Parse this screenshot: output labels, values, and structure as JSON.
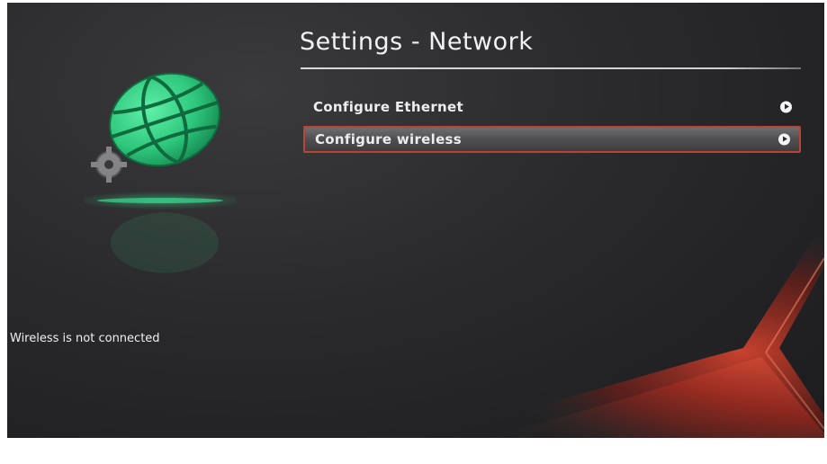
{
  "header": {
    "title": "Settings - Network"
  },
  "menu": {
    "items": [
      {
        "label": "Configure Ethernet",
        "selected": false
      },
      {
        "label": "Configure wireless",
        "selected": true
      }
    ]
  },
  "status": {
    "text": "Wireless is not connected"
  },
  "icons": {
    "network": "globe-gear-icon",
    "menu_arrow": "arrow-right-circle-icon"
  },
  "colors": {
    "background": "#2a2a2c",
    "accent_green": "#2ec77c",
    "selection_border": "#b84534",
    "swoosh_red": "#c0392b"
  }
}
